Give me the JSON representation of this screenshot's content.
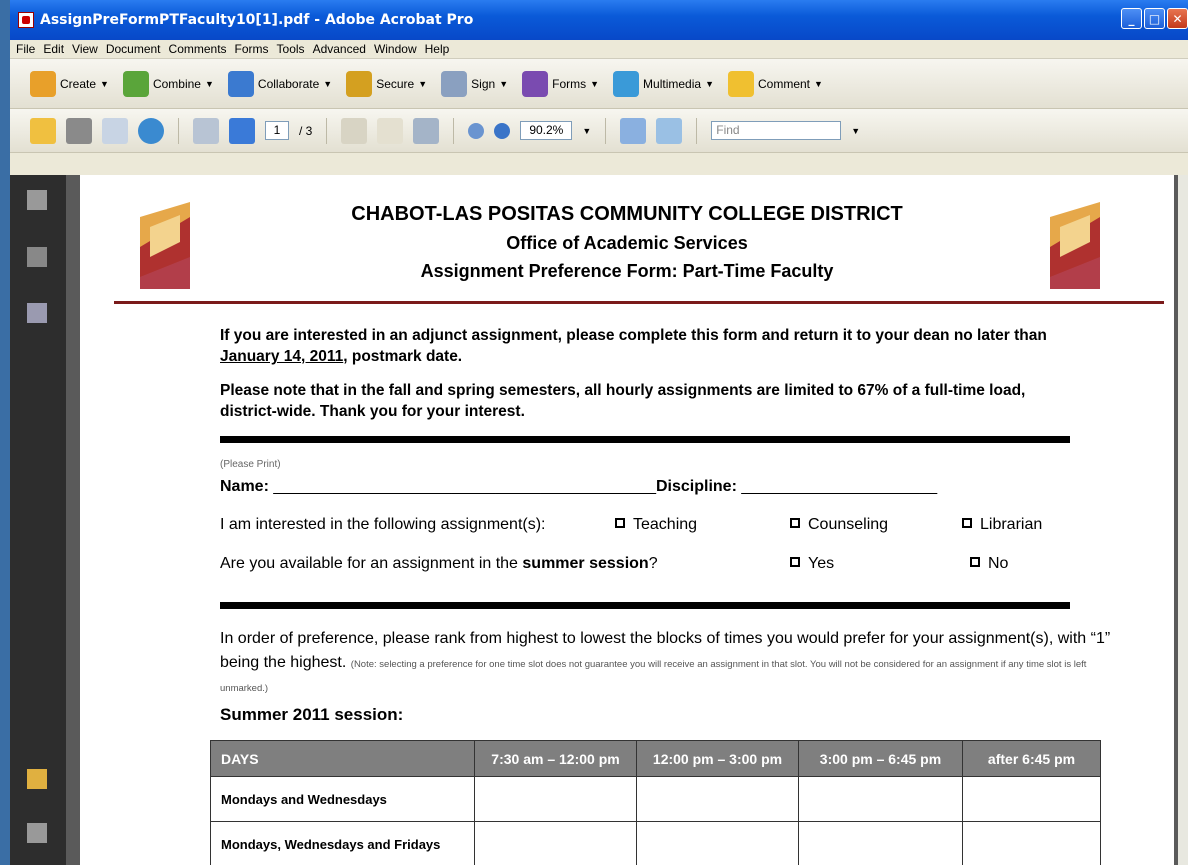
{
  "window": {
    "title": "AssignPreFormPTFaculty10[1].pdf - Adobe Acrobat Pro"
  },
  "menu": [
    "File",
    "Edit",
    "View",
    "Document",
    "Comments",
    "Forms",
    "Tools",
    "Advanced",
    "Window",
    "Help"
  ],
  "toolbar1": [
    {
      "id": "create",
      "label": "Create",
      "icon": "create-icon",
      "color": "#e8a02a"
    },
    {
      "id": "combine",
      "label": "Combine",
      "icon": "combine-icon",
      "color": "#5aa53a"
    },
    {
      "id": "collaborate",
      "label": "Collaborate",
      "icon": "collaborate-icon",
      "color": "#3b7ad0"
    },
    {
      "id": "secure",
      "label": "Secure",
      "icon": "lock-icon",
      "color": "#d4a020"
    },
    {
      "id": "sign",
      "label": "Sign",
      "icon": "pen-icon",
      "color": "#8aa0c0"
    },
    {
      "id": "forms",
      "label": "Forms",
      "icon": "forms-icon",
      "color": "#7a4bb0"
    },
    {
      "id": "multimedia",
      "label": "Multimedia",
      "icon": "multimedia-icon",
      "color": "#3a9ad8"
    },
    {
      "id": "comment",
      "label": "Comment",
      "icon": "comment-icon",
      "color": "#f0c030"
    }
  ],
  "toolbar2": {
    "page_current": "1",
    "page_total": "/ 3",
    "zoom": "90.2%",
    "find_placeholder": "Find"
  },
  "document": {
    "heading1": "CHABOT-LAS POSITAS COMMUNITY COLLEGE DISTRICT",
    "heading2": "Office of Academic Services",
    "heading3": "Assignment Preference Form: Part-Time Faculty",
    "para1_a": "If you are interested in an adjunct assignment, please complete this form and return it to your dean no later than ",
    "para1_date": "January 14, 2011",
    "para1_b": ", postmark date.",
    "para2": "Please note that in the fall and spring semesters, all hourly assignments are limited to 67% of a full-time load, district-wide. Thank you for your interest.",
    "please_print": "(Please Print)",
    "name_label": "Name:",
    "name_line": "___________________________________________",
    "discipline_label": "Discipline:",
    "discipline_line": "______________________",
    "interest_q": "I am interested in the following assignment(s):",
    "opt_teaching": "Teaching",
    "opt_counseling": "Counseling",
    "opt_librarian": "Librarian",
    "summer_q_a": "Are you available for an assignment in the ",
    "summer_q_b": "summer session",
    "summer_q_c": "?",
    "opt_yes": "Yes",
    "opt_no": "No",
    "rank_text": "In order of preference, please rank from highest to lowest the blocks of times you would prefer for your assignment(s), with “1” being the highest.",
    "rank_note": "(Note: selecting a preference for one time slot does not guarantee you will receive an assignment in that slot. You will not be considered for an assignment if any time slot is left unmarked.)",
    "summer_heading": "Summer 2011 session:",
    "table_headers": [
      "DAYS",
      "7:30 am – 12:00 pm",
      "12:00 pm – 3:00 pm",
      "3:00 pm – 6:45 pm",
      "after 6:45 pm"
    ],
    "table_rows": [
      "Mondays and Wednesdays",
      "Mondays, Wednesdays and Fridays"
    ]
  }
}
